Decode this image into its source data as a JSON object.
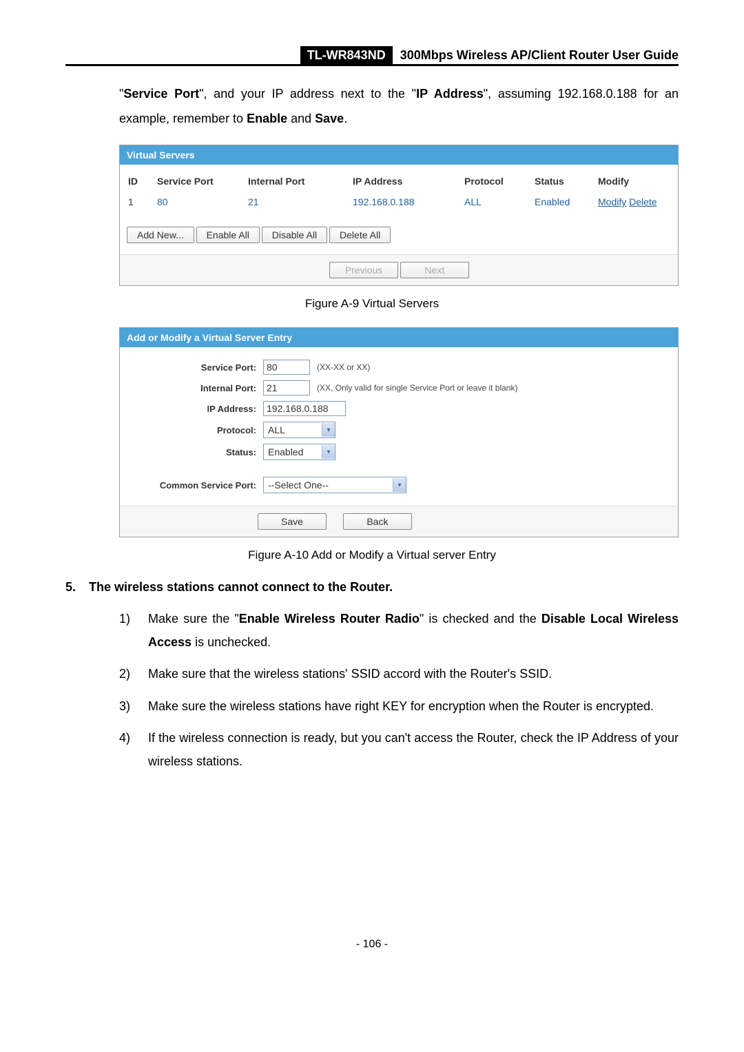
{
  "header": {
    "model": "TL-WR843ND",
    "title": "300Mbps Wireless AP/Client Router User Guide"
  },
  "intro": {
    "t1": "\"",
    "sp": "Service Port",
    "t2": "\", and your IP address next to the \"",
    "ip": "IP Address",
    "t3": "\", assuming 192.168.0.188 for an example, remember to ",
    "en": "Enable",
    "t4": " and ",
    "sv": "Save",
    "t5": "."
  },
  "virtual_servers": {
    "title": "Virtual Servers",
    "headers": {
      "id": "ID",
      "sp": "Service Port",
      "ipt": "Internal Port",
      "ipa": "IP Address",
      "proto": "Protocol",
      "status": "Status",
      "mod": "Modify"
    },
    "row": {
      "id": "1",
      "sp": "80",
      "ipt": "21",
      "ipa": "192.168.0.188",
      "proto": "ALL",
      "status": "Enabled",
      "modify": "Modify",
      "delete": "Delete"
    },
    "buttons": {
      "add": "Add New...",
      "enable": "Enable All",
      "disable": "Disable All",
      "delete": "Delete All",
      "prev": "Previous",
      "next": "Next"
    }
  },
  "fig9": "Figure A-9    Virtual Servers",
  "add_entry": {
    "title": "Add or Modify a Virtual Server Entry",
    "labels": {
      "sp": "Service Port:",
      "ipt": "Internal Port:",
      "ipa": "IP Address:",
      "proto": "Protocol:",
      "status": "Status:",
      "csp": "Common Service Port:"
    },
    "values": {
      "sp": "80",
      "ipt": "21",
      "ipa": "192.168.0.188",
      "proto": "ALL",
      "status": "Enabled",
      "csp": "--Select One--"
    },
    "hints": {
      "sp": "(XX-XX or XX)",
      "ipt": "(XX, Only valid for single Service Port or leave it blank)"
    },
    "buttons": {
      "save": "Save",
      "back": "Back"
    }
  },
  "fig10": "Figure A-10    Add or Modify a Virtual server Entry",
  "section5": {
    "num": "5.",
    "title": "The wireless stations cannot connect to the Router."
  },
  "items": {
    "i1n": "1)",
    "i1a": "Make sure the \"",
    "i1b": "Enable Wireless Router Radio",
    "i1c": "\" is checked and the ",
    "i1d": "Disable Local Wireless Access",
    "i1e": " is unchecked.",
    "i2n": "2)",
    "i2": "Make sure that the wireless stations' SSID accord with the Router's SSID.",
    "i3n": "3)",
    "i3": "Make sure the wireless stations have right KEY for encryption when the Router is encrypted.",
    "i4n": "4)",
    "i4": "If the wireless connection is ready, but you can't access the Router, check the IP Address of your wireless stations."
  },
  "pagenum": "- 106 -"
}
